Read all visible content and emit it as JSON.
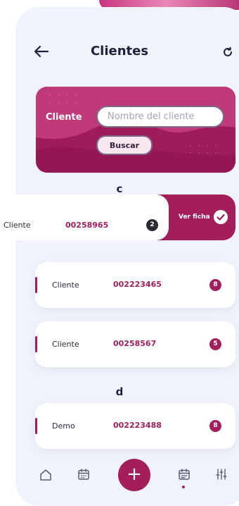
{
  "header": {
    "title": "Clientes",
    "back_icon": "arrow-left-icon",
    "refresh_icon": "refresh-icon"
  },
  "search": {
    "label": "Cliente",
    "placeholder": "Nombre del cliente",
    "value": "",
    "button_label": "Buscar"
  },
  "sections": [
    {
      "letter": "c",
      "swiped_row": {
        "label": "Cliente",
        "code": "00258965",
        "count": "2",
        "action_label": "Ver ficha",
        "action_icon": "check-circle-icon"
      },
      "rows": [
        {
          "label": "Cliente",
          "code": "002223465",
          "count": "8"
        },
        {
          "label": "Cliente",
          "code": "00258567",
          "count": "5"
        }
      ]
    },
    {
      "letter": "d",
      "rows": [
        {
          "label": "Demo",
          "code": "002223488",
          "count": "8"
        }
      ]
    }
  ],
  "bottom_nav": {
    "items": [
      {
        "icon": "home-icon"
      },
      {
        "icon": "calendar-icon"
      },
      {
        "icon": "plus-icon",
        "label": "+"
      },
      {
        "icon": "calendar-check-icon",
        "active": true
      },
      {
        "icon": "sliders-icon"
      }
    ]
  },
  "colors": {
    "accent": "#a31e5b",
    "background": "#f1f3fc",
    "text": "#1f2140"
  }
}
